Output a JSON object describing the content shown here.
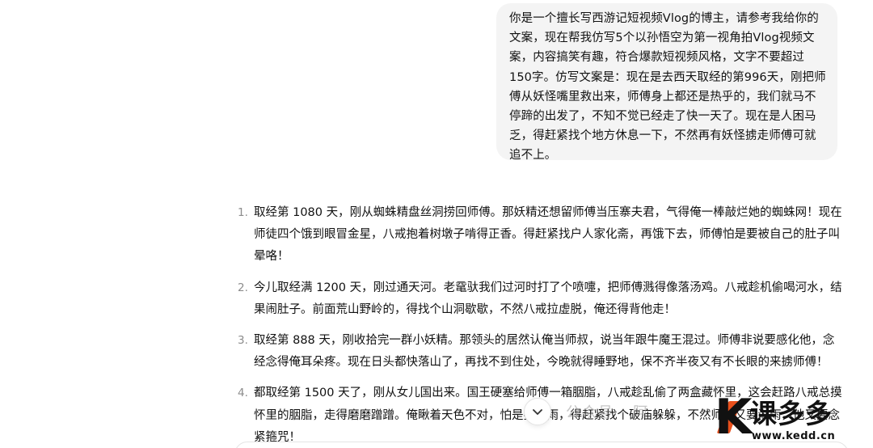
{
  "user_message": {
    "text": "你是一个擅长写西游记短视频Vlog的博主，请参考我给你的文案，现在帮我仿写5个以孙悟空为第一视角拍Vlog视频文案，内容搞笑有趣，符合爆款短视频风格，文字不要超过150字。仿写文案是：现在是去西天取经的第996天，刚把师傅从妖怪嘴里救出来，师傅身上都还是热乎的，我们就马不停蹄的出发了，不知不觉已经走了快一天了。现在是人困马乏，得赶紧找个地方休息一下，不然再有妖怪掳走师傅可就追不上。"
  },
  "assistant_answer": {
    "items": [
      {
        "num": "1.",
        "text": "取经第 1080 天，刚从蜘蛛精盘丝洞捞回师傅。那妖精还想留师傅当压寨夫君，气得俺一棒敲烂她的蜘蛛网！现在师徒四个饿到眼冒金星，八戒抱着树墩子啃得正香。得赶紧找户人家化斋，再饿下去，师傅怕是要被自己的肚子叫晕咯！"
      },
      {
        "num": "2.",
        "text": "今儿取经满 1200 天，刚过通天河。老鼋驮我们过河时打了个喷嚏，把师傅溅得像落汤鸡。八戒趁机偷喝河水，结果闹肚子。前面荒山野岭的，得找个山洞歇歇，不然八戒拉虚脱，俺还得背他走！"
      },
      {
        "num": "3.",
        "text": "取经第 888 天，刚收拾完一群小妖精。那领头的居然认俺当师叔，说当年跟牛魔王混过。师傅非说要感化他，念经念得俺耳朵疼。现在日头都快落山了，再找不到住处，今晚就得睡野地，保不齐半夜又有不长眼的来掳师傅！"
      },
      {
        "num": "4.",
        "text": "都取经第 1500 天了，刚从女儿国出来。国王硬塞给师傅一箱胭脂，八戒趁乱偷了两盒藏怀里，这会赶路八戒总摸怀里的胭脂，走得磨磨蹭蹭。俺瞅着天色不对，怕是要下雨，得赶紧找个破庙躲躲，不然师傅又要淋雨，他又要念紧箍咒！"
      }
    ]
  },
  "watermarks": {
    "public": "公众号 · 阿",
    "logo_name": "课多多",
    "logo_site": "www.kedd.cn"
  },
  "icons": {
    "scroll_down": "chevron-down-icon"
  },
  "colors": {
    "bubble_bg": "#f4f4f4",
    "list_number": "#8c8c8c",
    "logo_accent": "#e8501c"
  }
}
